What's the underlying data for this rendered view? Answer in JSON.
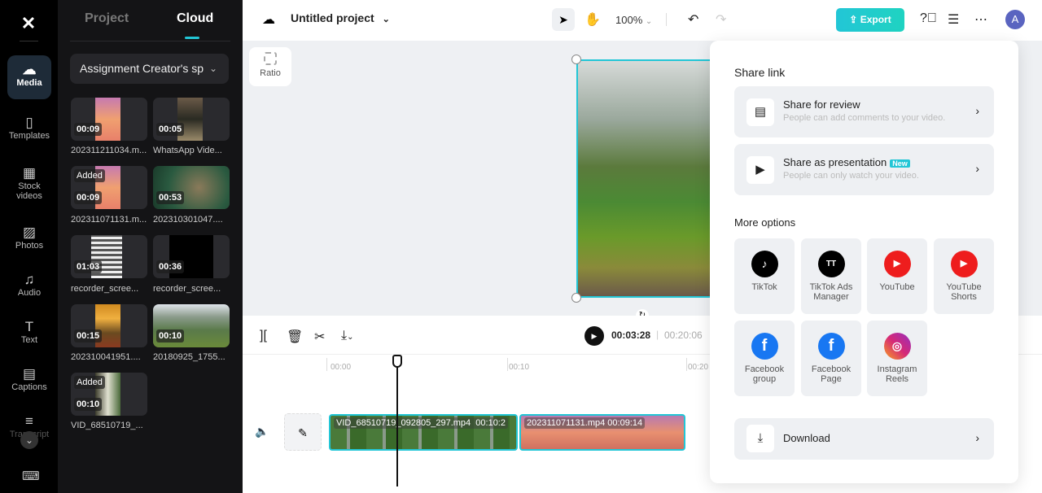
{
  "rail": {
    "logo": "CapCut",
    "items": [
      {
        "label": "Media",
        "icon": "cloud-upload-icon",
        "glyph": "☁"
      },
      {
        "label": "Templates",
        "icon": "templates-icon",
        "glyph": "▯"
      },
      {
        "label": "Stock videos",
        "icon": "film-icon",
        "glyph": "▦"
      },
      {
        "label": "Photos",
        "icon": "image-icon",
        "glyph": "▨"
      },
      {
        "label": "Audio",
        "icon": "music-icon",
        "glyph": "♫"
      },
      {
        "label": "Text",
        "icon": "text-icon",
        "glyph": "T"
      },
      {
        "label": "Captions",
        "icon": "captions-icon",
        "glyph": "▤"
      },
      {
        "label": "Transcript",
        "icon": "transcript-icon",
        "glyph": "≡"
      }
    ],
    "collapse_glyph": "⌄",
    "keyboard_glyph": "⌨"
  },
  "panel": {
    "tabs": [
      "Project",
      "Cloud"
    ],
    "active_tab": "Cloud",
    "space": "Assignment Creator's sp",
    "media": [
      {
        "name": "202311211034.m...",
        "duration": "00:09",
        "added": false
      },
      {
        "name": "WhatsApp Vide...",
        "duration": "00:05",
        "added": false
      },
      {
        "name": "202311071131.m...",
        "duration": "00:09",
        "added": true
      },
      {
        "name": "202310301047....",
        "duration": "00:53",
        "added": false
      },
      {
        "name": "recorder_scree...",
        "duration": "01:03",
        "added": false
      },
      {
        "name": "recorder_scree...",
        "duration": "00:36",
        "added": false
      },
      {
        "name": "202310041951....",
        "duration": "00:15",
        "added": false
      },
      {
        "name": "20180925_1755...",
        "duration": "00:10",
        "added": false
      },
      {
        "name": "VID_68510719_...",
        "duration": "00:10",
        "added": true
      }
    ],
    "added_label": "Added"
  },
  "topbar": {
    "project_title": "Untitled project",
    "zoom": "100%",
    "export_label": "Export",
    "avatar_initial": "A"
  },
  "canvas": {
    "ratio_label": "Ratio"
  },
  "timeline": {
    "current_time": "00:03:28",
    "total_time": "00:20:06",
    "ticks": [
      "00:00",
      "00:10",
      "00:20"
    ],
    "clips": [
      {
        "name": "VID_68510719_092805_297.mp4",
        "duration": "00:10:2"
      },
      {
        "name": "202311071131.mp4",
        "duration": "00:09:14"
      }
    ]
  },
  "share_popup": {
    "share_link_title": "Share link",
    "share_review": {
      "title": "Share for review",
      "subtitle": "People can add comments to your video."
    },
    "share_presentation": {
      "title": "Share as presentation",
      "badge": "New",
      "subtitle": "People can only watch your video."
    },
    "more_options_title": "More options",
    "options": [
      {
        "label": "TikTok",
        "color": "#000000",
        "glyph": "♪"
      },
      {
        "label": "TikTok Ads Manager",
        "color": "#000000",
        "glyph": "TT"
      },
      {
        "label": "YouTube",
        "color": "#ee1d1d",
        "glyph": "▶"
      },
      {
        "label": "YouTube Shorts",
        "color": "#ee1d1d",
        "glyph": "▶"
      },
      {
        "label": "Facebook group",
        "color": "#1877f2",
        "glyph": "f"
      },
      {
        "label": "Facebook Page",
        "color": "#1877f2",
        "glyph": "f"
      },
      {
        "label": "Instagram Reels",
        "color": "#d62976",
        "glyph": "◎"
      }
    ],
    "download_label": "Download"
  },
  "colors": {
    "accent": "#22c6d6"
  }
}
